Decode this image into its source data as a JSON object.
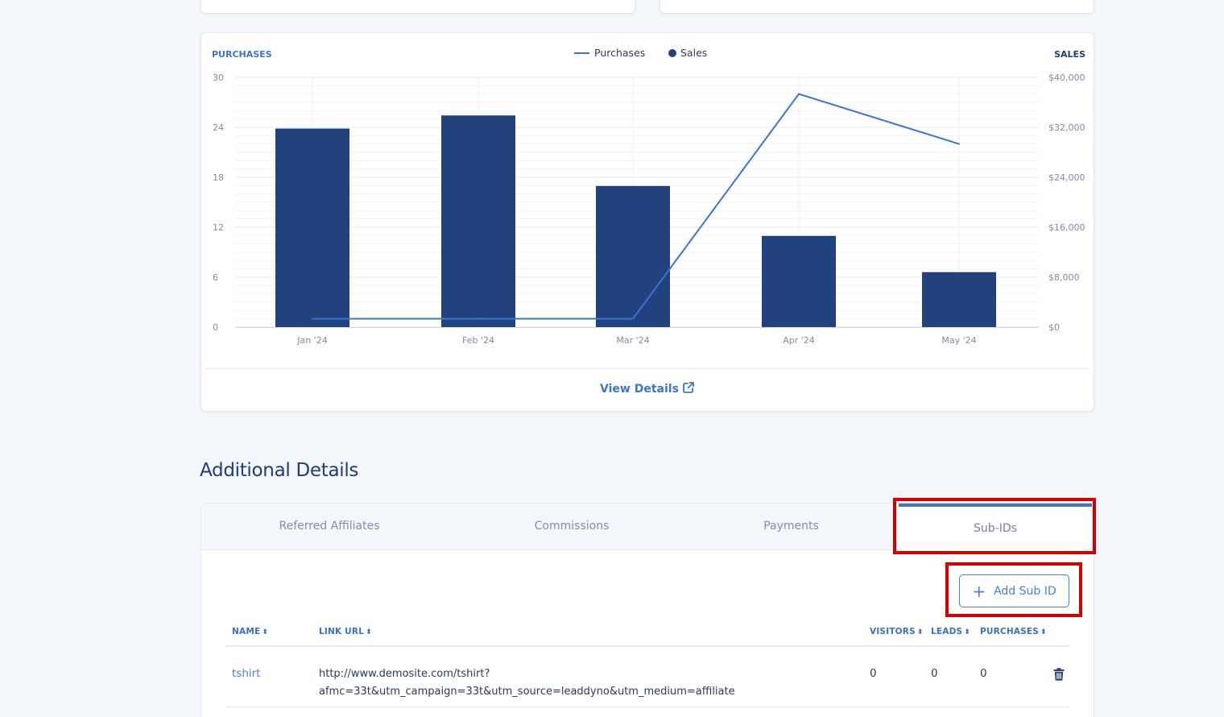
{
  "chart_data": {
    "type": "bar",
    "categories": [
      "Jan '24",
      "Feb '24",
      "Mar '24",
      "Apr '24",
      "May '24"
    ],
    "series": [
      {
        "name": "Sales",
        "type": "bar",
        "axis": "right",
        "values": [
          31800,
          33900,
          22600,
          14600,
          8800
        ]
      },
      {
        "name": "Purchases",
        "type": "line",
        "axis": "left",
        "values": [
          1,
          1,
          1,
          28,
          22
        ]
      }
    ],
    "ylabel_left": "PURCHASES",
    "ylabel_right": "SALES",
    "ylim_left": [
      0,
      30
    ],
    "ylim_right": [
      0,
      40000
    ],
    "yticks_left": [
      "0",
      "6",
      "12",
      "18",
      "24",
      "30"
    ],
    "yticks_right": [
      "$0",
      "$8,000",
      "$16,000",
      "$24,000",
      "$32,000",
      "$40,000"
    ],
    "legend": [
      "Purchases",
      "Sales"
    ],
    "legend_position": "top-center",
    "grid": true,
    "colors": {
      "bar": "#21427d",
      "line": "#3a75d6"
    }
  },
  "chart_footer": {
    "view_details_label": "View Details"
  },
  "section": {
    "title": "Additional Details"
  },
  "tabs": [
    {
      "label": "Referred Affiliates",
      "active": false
    },
    {
      "label": "Commissions",
      "active": false
    },
    {
      "label": "Payments",
      "active": false
    },
    {
      "label": "Sub-IDs",
      "active": true
    }
  ],
  "subids": {
    "add_button_label": "Add Sub ID",
    "columns": [
      "NAME",
      "LINK URL",
      "VISITORS",
      "LEADS",
      "PURCHASES"
    ],
    "rows": [
      {
        "name": "tshirt",
        "url_line1": "http://www.demosite.com/tshirt?",
        "url_line2": "afmc=33t&utm_campaign=33t&utm_source=leaddyno&utm_medium=affiliate",
        "visitors": "0",
        "leads": "0",
        "purchases": "0"
      }
    ]
  },
  "colors": {
    "accent": "#3a75d6",
    "highlight": "#d40000",
    "title": "#1e3d78"
  }
}
